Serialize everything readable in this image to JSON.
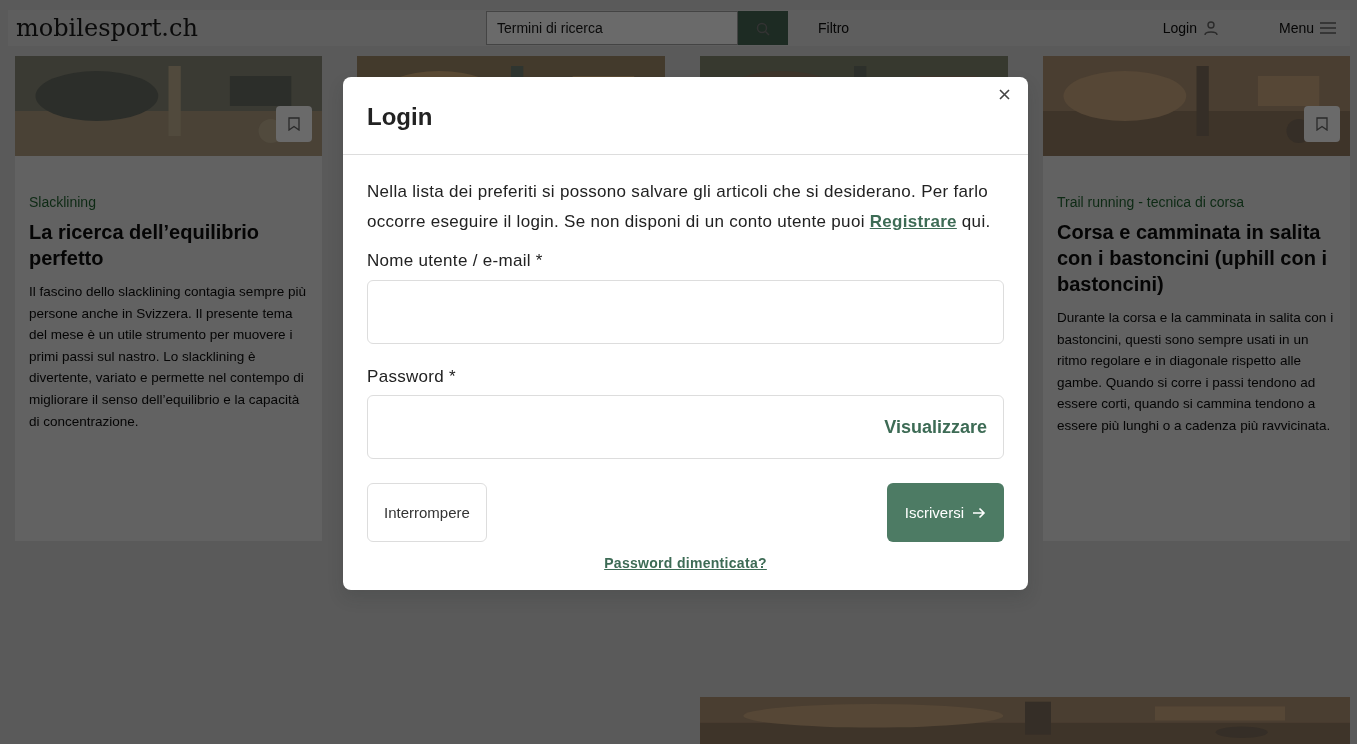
{
  "header": {
    "logo": "mobilesport.ch",
    "search": {
      "placeholder": "Termini di ricerca"
    },
    "filter": "Filtro",
    "login": "Login",
    "menu": "Menu"
  },
  "articles": [
    {
      "kind": "article",
      "category": "Slacklining",
      "title": "La ricerca dell’equilibrio perfetto",
      "summary": "Il fascino dello slacklining contagia sempre più persone anche in Svizzera. Il presente tema del mese è un utile strumento per muovere i primi passi sul nastro. Lo slacklining è divertente, variato e permette nel contempo di migliorare il senso dell’equilibrio e la capacità di concentrazione."
    },
    {
      "kind": "picture"
    },
    {
      "kind": "picture"
    },
    {
      "kind": "article",
      "category": "Trail running - tecnica di corsa",
      "title": "Corsa e camminata in salita con i bastoncini (uphill con i bastoncini)",
      "summary": "Durante la corsa e la camminata in salita con i bastoncini, questi sono sempre usati in un ritmo regolare e in diagonale rispetto alle gambe. Quando si corre i passi tendono ad essere corti, quando si cammina tendono a essere più lunghi o a cadenza più ravvicinata."
    }
  ],
  "modal": {
    "title": "Login",
    "intro": "Nella lista dei preferiti si possono salvare gli articoli che si desiderano. Per farlo occorre eseguire il login. Se non disponi di un conto utente puoi ",
    "register_link": "Registrare",
    "intro_end": " qui.",
    "fields": [
      {
        "kind": "text",
        "label": "Nome utente / e-mail *"
      },
      {
        "kind": "password",
        "label": "Password *",
        "toggle": "Visualizzare"
      }
    ],
    "cancel": "Interrompere",
    "submit": "Iscriversi",
    "forgot": "Password dimenticata?"
  }
}
